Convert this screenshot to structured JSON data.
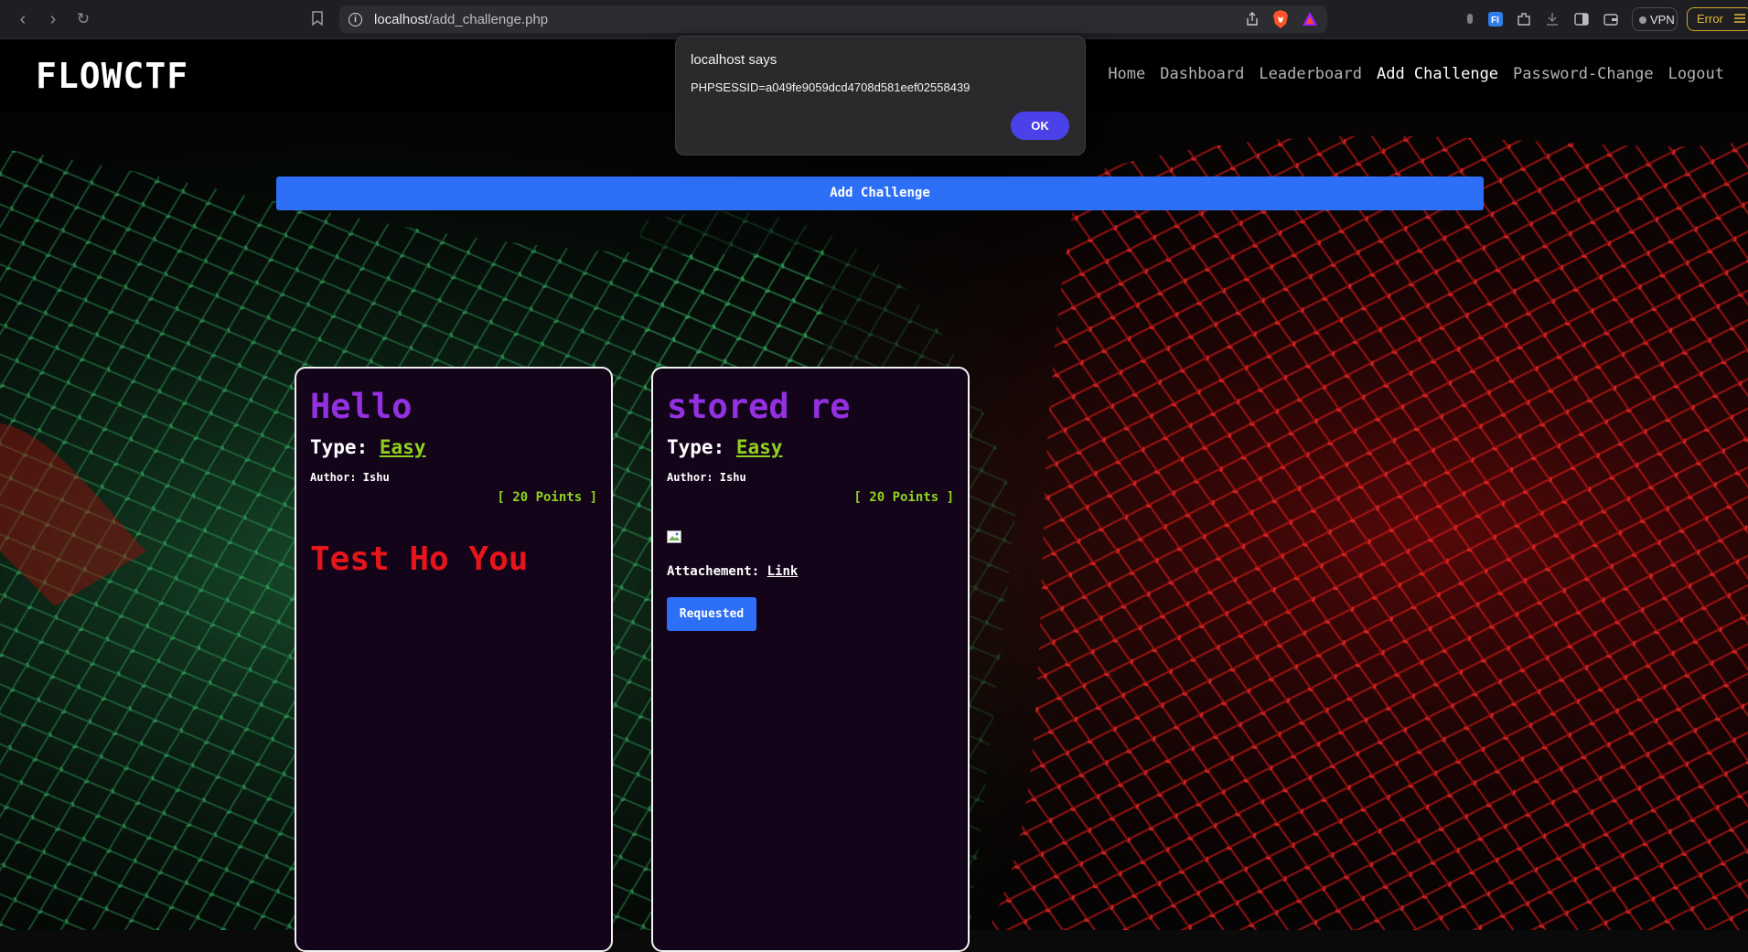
{
  "browser": {
    "url_host": "localhost",
    "url_path": "/add_challenge.php",
    "vpn_label": "VPN",
    "error_label": "Error"
  },
  "site": {
    "logo": "FLOWCTF",
    "nav": [
      {
        "label": "Home"
      },
      {
        "label": "Dashboard"
      },
      {
        "label": "Leaderboard"
      },
      {
        "label": "Add Challenge"
      },
      {
        "label": "Password-Change"
      },
      {
        "label": "Logout"
      }
    ],
    "add_challenge_button": "Add Challenge"
  },
  "cards": [
    {
      "title": "Hello",
      "type_label": "Type:",
      "type_value": "Easy",
      "author": "Author: Ishu",
      "points": "[ 20 Points ]",
      "description": "Test Ho You"
    },
    {
      "title": "stored re",
      "type_label": "Type:",
      "type_value": "Easy",
      "author": "Author: Ishu",
      "points": "[ 20 Points ]",
      "attachment_label": "Attachement:",
      "attachment_link": "Link",
      "button": "Requested"
    }
  ],
  "dialog": {
    "title": "localhost says",
    "message": "PHPSESSID=a049fe9059dcd4708d581eef02558439",
    "ok": "OK"
  },
  "colors": {
    "accent_blue": "#2e6ff7",
    "title_purple": "#9330e0",
    "points_green": "#8fd21c",
    "desc_red": "#e6141b",
    "dialog_button": "#4b41e8"
  }
}
